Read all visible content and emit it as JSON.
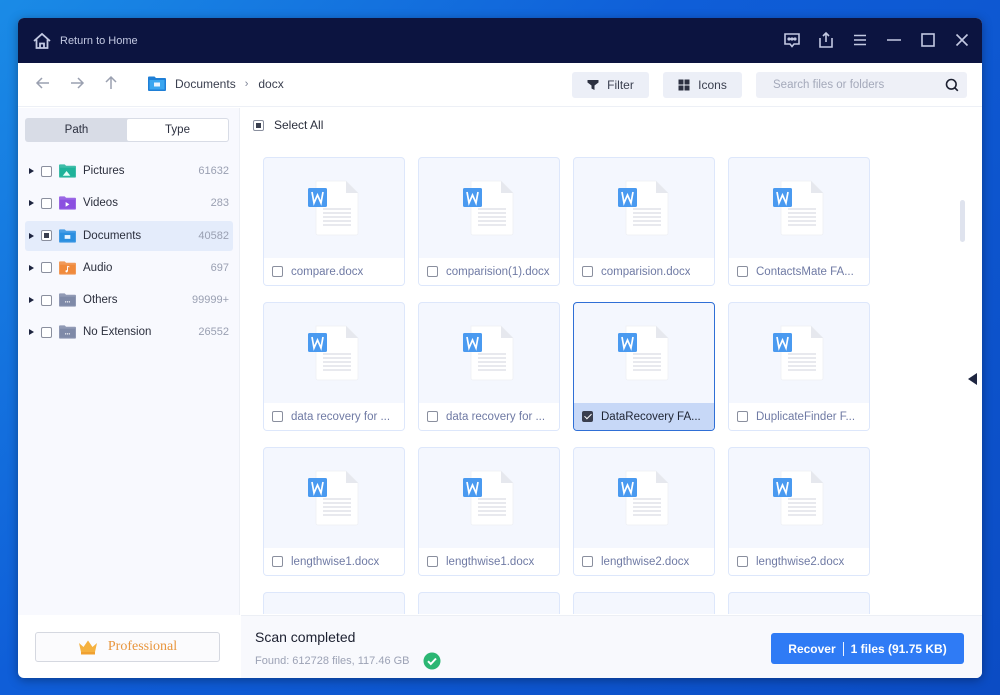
{
  "titlebar": {
    "home_label": "Return to Home",
    "icons": [
      "feedback-icon",
      "share-icon",
      "menu-icon",
      "minimize-icon",
      "maximize-icon",
      "close-icon"
    ]
  },
  "navbar": {
    "breadcrumb": [
      "Documents",
      "docx"
    ],
    "filter_label": "Filter",
    "view_label": "Icons",
    "search_placeholder": "Search files or folders",
    "search_value": ""
  },
  "sidebar": {
    "tabs": [
      {
        "label": "Path",
        "active": false
      },
      {
        "label": "Type",
        "active": true
      }
    ],
    "items": [
      {
        "label": "Pictures",
        "count": "61632",
        "icon": "pictures-folder-icon",
        "checked": "none",
        "selected": false,
        "color": "#1fb39a"
      },
      {
        "label": "Videos",
        "count": "283",
        "icon": "videos-folder-icon",
        "checked": "none",
        "selected": false,
        "color": "#8b4fe0"
      },
      {
        "label": "Documents",
        "count": "40582",
        "icon": "documents-folder-icon",
        "checked": "partial",
        "selected": true,
        "color": "#2b8fe0"
      },
      {
        "label": "Audio",
        "count": "697",
        "icon": "audio-folder-icon",
        "checked": "none",
        "selected": false,
        "color": "#f08a3c"
      },
      {
        "label": "Others",
        "count": "99999+",
        "icon": "others-folder-icon",
        "checked": "none",
        "selected": false,
        "color": "#7f8aa8"
      },
      {
        "label": "No Extension",
        "count": "26552",
        "icon": "no-extension-folder-icon",
        "checked": "none",
        "selected": false,
        "color": "#7f8aa8"
      }
    ],
    "edition_label": "Professional"
  },
  "main": {
    "select_all_label": "Select All",
    "files": [
      {
        "name": "compare.docx",
        "selected": false
      },
      {
        "name": "comparision(1).docx",
        "selected": false
      },
      {
        "name": "comparision.docx",
        "selected": false
      },
      {
        "name": "ContactsMate FA...",
        "selected": false
      },
      {
        "name": "data recovery for ...",
        "selected": false
      },
      {
        "name": "data recovery for ...",
        "selected": false
      },
      {
        "name": "DataRecovery FA...",
        "selected": true
      },
      {
        "name": "DuplicateFinder F...",
        "selected": false
      },
      {
        "name": "lengthwise1.docx",
        "selected": false
      },
      {
        "name": "lengthwise1.docx",
        "selected": false
      },
      {
        "name": "lengthwise2.docx",
        "selected": false
      },
      {
        "name": "lengthwise2.docx",
        "selected": false
      }
    ],
    "partial_row_count": 4
  },
  "status": {
    "title": "Scan completed",
    "found": "Found: 612728 files, 117.46 GB",
    "recover_label": "Recover",
    "recover_detail": "1 files (91.75 KB)"
  },
  "colors": {
    "titlebar_bg": "#0c1440",
    "accent": "#2f7bf5",
    "success": "#2bb673",
    "pro": "#e8963e"
  }
}
